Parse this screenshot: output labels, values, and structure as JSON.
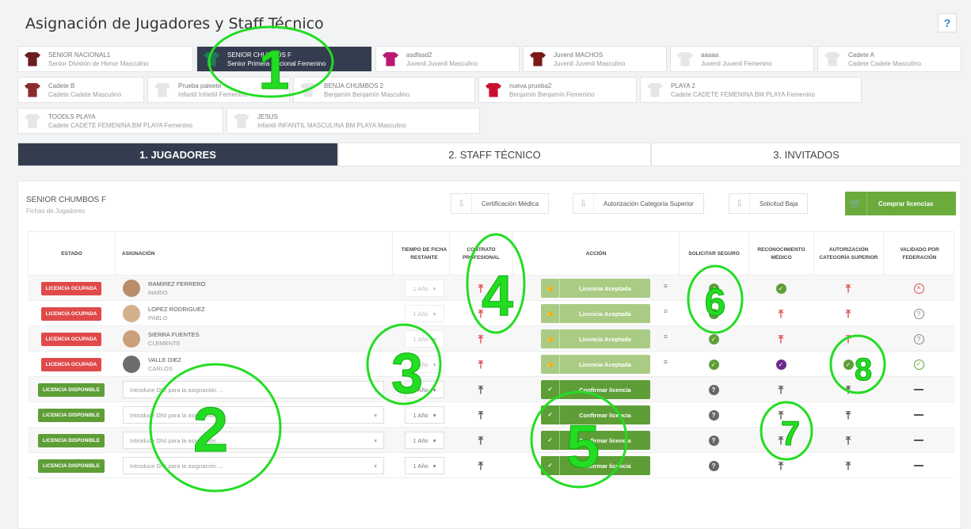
{
  "header": {
    "title": "Asignación de Jugadores y Staff Técnico",
    "help": "?"
  },
  "teams": [
    {
      "line1": "SENIOR NACIONAL1",
      "line2": "Senior División de Honor Masculino",
      "color": "#6b1e22"
    },
    {
      "line1": "SENIOR CHUMBOS F",
      "line2": "Senior Primera Nacional Femenino",
      "color": "#1f7a52"
    },
    {
      "line1": "asdfasd2",
      "line2": "Juvenil Juvenil Masculino",
      "color": "#b8196e"
    },
    {
      "line1": "Juvenil MACHOS",
      "line2": "Juvenil Juvenil Masculino",
      "color": "#7a1a1a"
    },
    {
      "line1": "aaaaa",
      "line2": "Juvenil Juvenil Femenino",
      "color": "#e6e6e6"
    },
    {
      "line1": "Cadete A",
      "line2": "Cadete Cadete Masculino",
      "color": "#e6e6e6"
    },
    {
      "line1": "Cadete B",
      "line2": "Cadete Cadete Masculino",
      "color": "#8b2b2b"
    },
    {
      "line1": "Prueba paleete",
      "line2": "Infantil Infantil Femenino",
      "color": "#e6e6e6"
    },
    {
      "line1": "BENJA CHUMBOS 2",
      "line2": "Benjamín Benjamín Masculino",
      "color": "#e6e6e6"
    },
    {
      "line1": "nueva prueba2",
      "line2": "Benjamín Benjamín Femenino",
      "color": "#c8102e"
    },
    {
      "line1": "PLAYA 2",
      "line2": "Cadete CADETE FEMENINA BM PLAYA Femenino",
      "color": "#e6e6e6"
    },
    {
      "line1": "TOODLS PLAYA",
      "line2": "Cadete CADETE FEMENINA BM PLAYA Femenino",
      "color": "#e6e6e6"
    },
    {
      "line1": "JESUS",
      "line2": "Infantil INFANTIL MASCULINA BM PLAYA Masculino",
      "color": "#e6e6e6"
    }
  ],
  "tabs": [
    "1. JUGADORES",
    "2. STAFF TÉCNICO",
    "3. INVITADOS"
  ],
  "panel": {
    "title": "SENIOR CHUMBOS F",
    "subtitle": "Fichas de Jugadores",
    "docs": [
      "Certificación Médica",
      "Autorización Categoría Superior",
      "Solicitud Baja"
    ],
    "buy": "Comprar licencias"
  },
  "table": {
    "headers": {
      "estado": "ESTADO",
      "asignacion": "ASIGNACIÓN",
      "tiempo": "TIEMPO DE FICHA RESTANTE",
      "contrato": "CONTRATO PROFESIONAL",
      "accion": "ACCIÓN",
      "seguro": "SOLICITAR SEGURO",
      "medico": "RECONOCIMIENTO MÉDICO",
      "autorizacion": "AUTORIZACIÓN CATEGORÍA SUPERIOR",
      "validado": "VALIDADO POR FEDERACIÓN"
    },
    "rows": [
      {
        "estado": "LICENCIA OCUPADA",
        "apellidos": "RAMIREZ FERRERO",
        "nombre": "MARIO",
        "years": "1 Año",
        "action": "Licencia Aceptada",
        "seguro": "ok",
        "medico": "ok",
        "autor": "up-red",
        "valid": "x"
      },
      {
        "estado": "LICENCIA OCUPADA",
        "apellidos": "LOPEZ RODRIGUEZ",
        "nombre": "PABLO",
        "years": "1 Año",
        "action": "Licencia Aceptada",
        "seguro": "ok",
        "medico": "up-red",
        "autor": "up-red",
        "valid": "q"
      },
      {
        "estado": "LICENCIA OCUPADA",
        "apellidos": "SIERRA FUENTES",
        "nombre": "CLEMENTE",
        "years": "1 Año",
        "action": "Licencia Aceptada",
        "seguro": "ok",
        "medico": "up-red",
        "autor": "up-red",
        "valid": "q"
      },
      {
        "estado": "LICENCIA OCUPADA",
        "apellidos": "VALLE DIEZ",
        "nombre": "CARLOS",
        "years": "1 Año",
        "action": "Licencia Aceptada",
        "seguro": "ok",
        "medico": "ok-purple",
        "autor": "ok",
        "valid": "okg"
      },
      {
        "estado": "LICENCIA DISPONIBLE",
        "placeholder": "Introduce DNI para la asignación ...",
        "years": "1 Año",
        "action": "Confirmar licencia",
        "seguro": "qf",
        "medico": "up-dark",
        "autor": "up-dark",
        "valid": "dash"
      },
      {
        "estado": "LICENCIA DISPONIBLE",
        "placeholder": "Introduce DNI para la asignación ...",
        "years": "1 Año",
        "action": "Confirmar licencia",
        "seguro": "qf",
        "medico": "up-dark",
        "autor": "up-dark",
        "valid": "dash"
      },
      {
        "estado": "LICENCIA DISPONIBLE",
        "placeholder": "Introduce DNI para la asignación ...",
        "years": "1 Año",
        "action": "Confirmar licencia",
        "seguro": "qf",
        "medico": "up-dark",
        "autor": "up-dark",
        "valid": "dash"
      },
      {
        "estado": "LICENCIA DISPONIBLE",
        "placeholder": "Introduce DNI para la asignación ...",
        "years": "1 Año",
        "action": "Confirmar licencia",
        "seguro": "qf",
        "medico": "up-dark",
        "autor": "up-dark",
        "valid": "dash"
      }
    ]
  },
  "annotations": [
    "1",
    "2",
    "3",
    "4",
    "5",
    "6",
    "7",
    "8"
  ],
  "colors": {
    "annotation": "#22dd22",
    "dark": "#343c4f",
    "green": "#5e9e37",
    "red": "#e04a4a"
  }
}
